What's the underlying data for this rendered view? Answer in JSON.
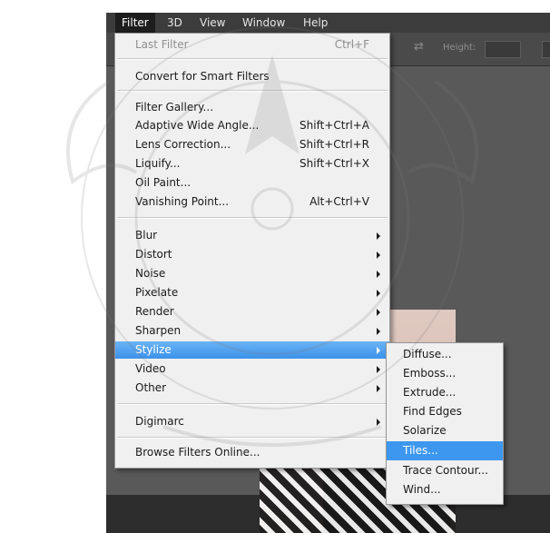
{
  "menubar": {
    "items": [
      {
        "label": "Filter",
        "active": true
      },
      {
        "label": "3D"
      },
      {
        "label": "View"
      },
      {
        "label": "Window"
      },
      {
        "label": "Help"
      }
    ]
  },
  "options_bar": {
    "height_label": "Height:"
  },
  "filter_menu": {
    "last_filter": {
      "label": "Last Filter",
      "shortcut": "Ctrl+F"
    },
    "convert_smart": {
      "label": "Convert for Smart Filters"
    },
    "filter_gallery": {
      "label": "Filter Gallery..."
    },
    "adaptive_wide_angle": {
      "label": "Adaptive Wide Angle...",
      "shortcut": "Shift+Ctrl+A"
    },
    "lens_correction": {
      "label": "Lens Correction...",
      "shortcut": "Shift+Ctrl+R"
    },
    "liquify": {
      "label": "Liquify...",
      "shortcut": "Shift+Ctrl+X"
    },
    "oil_paint": {
      "label": "Oil Paint..."
    },
    "vanishing_point": {
      "label": "Vanishing Point...",
      "shortcut": "Alt+Ctrl+V"
    },
    "blur": {
      "label": "Blur"
    },
    "distort": {
      "label": "Distort"
    },
    "noise": {
      "label": "Noise"
    },
    "pixelate": {
      "label": "Pixelate"
    },
    "render": {
      "label": "Render"
    },
    "sharpen": {
      "label": "Sharpen"
    },
    "stylize": {
      "label": "Stylize"
    },
    "video": {
      "label": "Video"
    },
    "other": {
      "label": "Other"
    },
    "digimarc": {
      "label": "Digimarc"
    },
    "browse_online": {
      "label": "Browse Filters Online..."
    }
  },
  "stylize_submenu": {
    "items": [
      {
        "label": "Diffuse..."
      },
      {
        "label": "Emboss..."
      },
      {
        "label": "Extrude..."
      },
      {
        "label": "Find Edges"
      },
      {
        "label": "Solarize"
      },
      {
        "label": "Tiles..."
      },
      {
        "label": "Trace Contour..."
      },
      {
        "label": "Wind..."
      }
    ]
  },
  "colors": {
    "highlight": "#3d97ef",
    "menu_bg": "#f0f0f0",
    "app_dark": "#3c3c3c"
  }
}
